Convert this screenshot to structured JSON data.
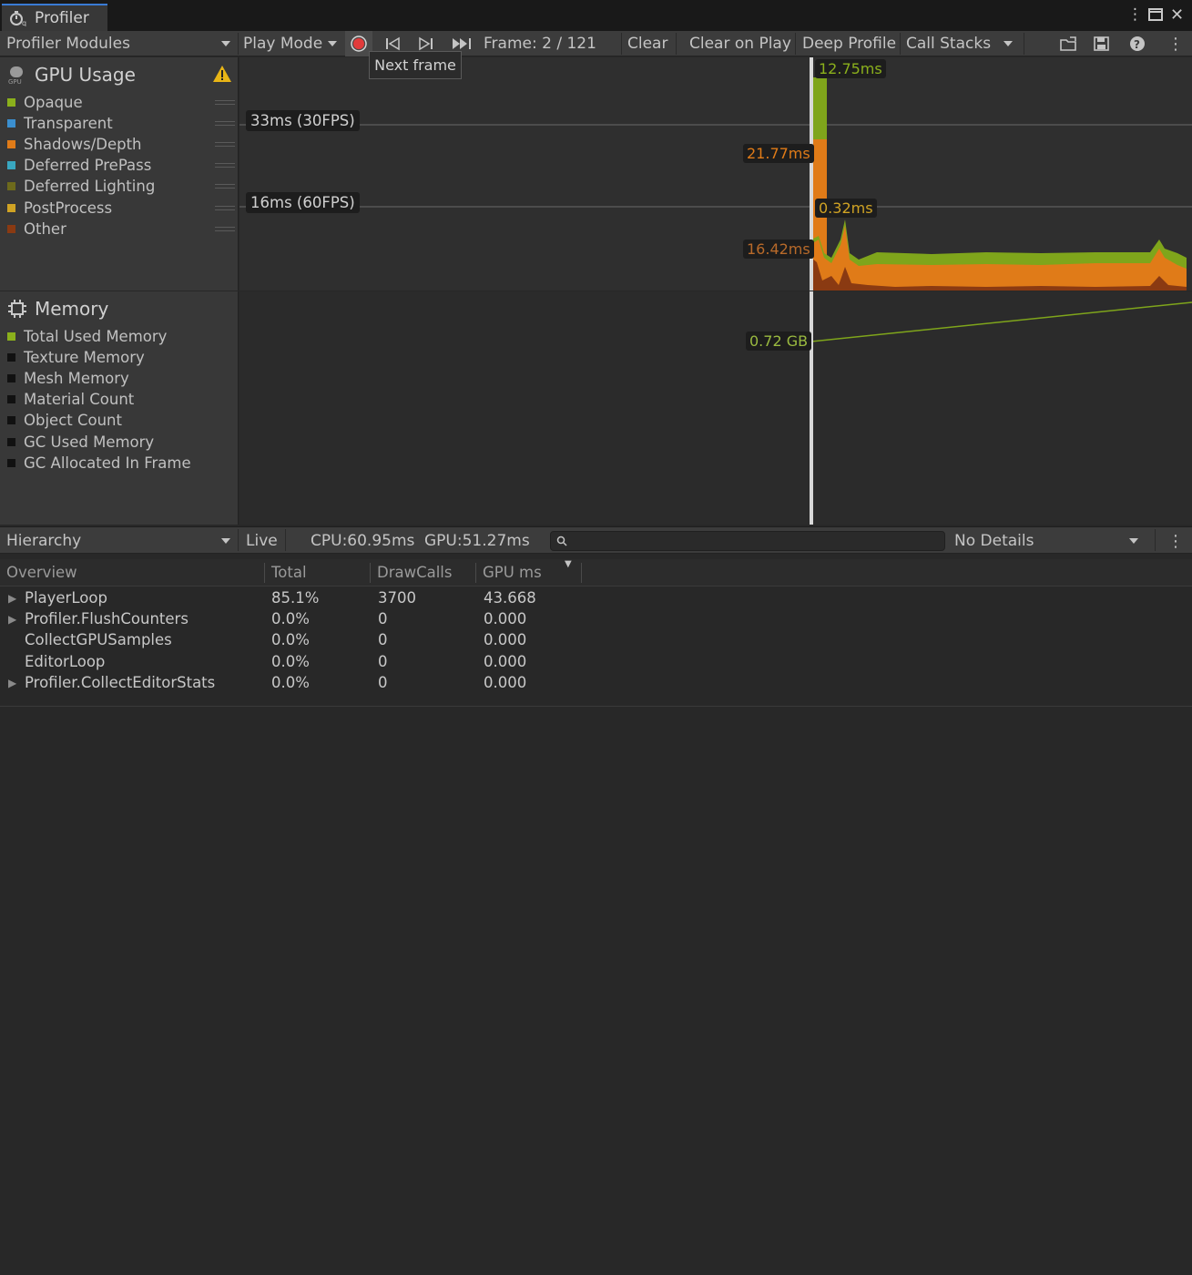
{
  "window": {
    "tab_title": "Profiler"
  },
  "toolbar": {
    "modules_dropdown": "Profiler Modules",
    "target_dropdown": "Play Mode",
    "frame_label": "Frame: 2 / 121",
    "clear": "Clear",
    "clear_on_play": "Clear on Play",
    "deep_profile": "Deep Profile",
    "call_stacks": "Call Stacks"
  },
  "tooltip": "Next frame",
  "gpu_module": {
    "title": "GPU Usage",
    "legend": [
      {
        "label": "Opaque",
        "color": "#8bb01c"
      },
      {
        "label": "Transparent",
        "color": "#3b8fcf"
      },
      {
        "label": "Shadows/Depth",
        "color": "#e07b18"
      },
      {
        "label": "Deferred PrePass",
        "color": "#39a7c0"
      },
      {
        "label": "Deferred Lighting",
        "color": "#6d6a1c"
      },
      {
        "label": "PostProcess",
        "color": "#d0a324"
      },
      {
        "label": "Other",
        "color": "#8a3a12"
      }
    ],
    "fps_30": "33ms (30FPS)",
    "fps_60": "16ms (60FPS)",
    "val_top": "12.75ms",
    "val_mid": "21.77ms",
    "val_small": "0.32ms",
    "val_low": "16.42ms"
  },
  "memory_module": {
    "title": "Memory",
    "legend": [
      {
        "label": "Total Used Memory",
        "color": "#8bb01c"
      },
      {
        "label": "Texture Memory",
        "color": "#111111"
      },
      {
        "label": "Mesh Memory",
        "color": "#111111"
      },
      {
        "label": "Material Count",
        "color": "#111111"
      },
      {
        "label": "Object Count",
        "color": "#111111"
      },
      {
        "label": "GC Used Memory",
        "color": "#111111"
      },
      {
        "label": "GC Allocated In Frame",
        "color": "#111111"
      }
    ],
    "val": "0.72 GB"
  },
  "hierarchy_bar": {
    "view_dropdown": "Hierarchy",
    "live": "Live",
    "cpu": "CPU:60.95ms",
    "gpu": "GPU:51.27ms",
    "details_dropdown": "No Details"
  },
  "table": {
    "headers": [
      "Overview",
      "Total",
      "DrawCalls",
      "GPU ms"
    ],
    "rows": [
      {
        "name": "PlayerLoop",
        "total": "85.1%",
        "drawcalls": "3700",
        "gpums": "43.668"
      },
      {
        "name": "Profiler.FlushCounters",
        "total": "0.0%",
        "drawcalls": "0",
        "gpums": "0.000"
      },
      {
        "name": "CollectGPUSamples",
        "total": "0.0%",
        "drawcalls": "0",
        "gpums": "0.000"
      },
      {
        "name": "EditorLoop",
        "total": "0.0%",
        "drawcalls": "0",
        "gpums": "0.000"
      },
      {
        "name": "Profiler.CollectEditorStats",
        "total": "0.0%",
        "drawcalls": "0",
        "gpums": "0.000"
      }
    ]
  }
}
